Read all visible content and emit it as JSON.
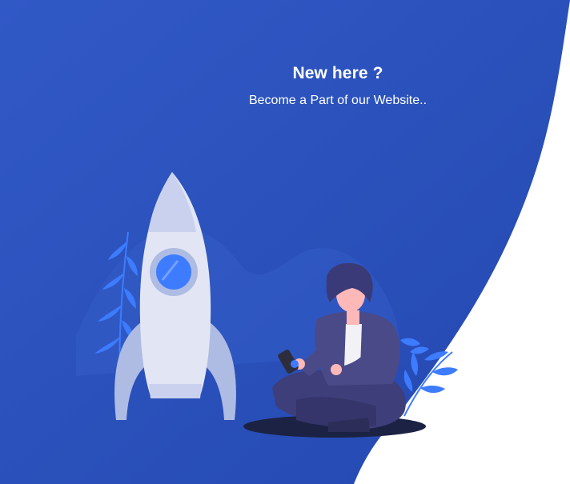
{
  "panel": {
    "title": "New here ?",
    "subtitle": "Become a Part of our Website.."
  },
  "colors": {
    "panel_bg": "#2e56c2",
    "panel_bg_dark": "#2449b3",
    "page_bg": "#ffffff",
    "rocket_body": "#e2e6f4",
    "rocket_fin": "#aebbe3",
    "porthole": "#3d7bff",
    "plant": "#3d7bff",
    "person_clothes": "#4a4a88",
    "shadow": "#1c2244"
  },
  "illustration": {
    "rocket": "rocket-icon",
    "person": "person-with-phone-icon",
    "plants": "leaf-icon"
  }
}
